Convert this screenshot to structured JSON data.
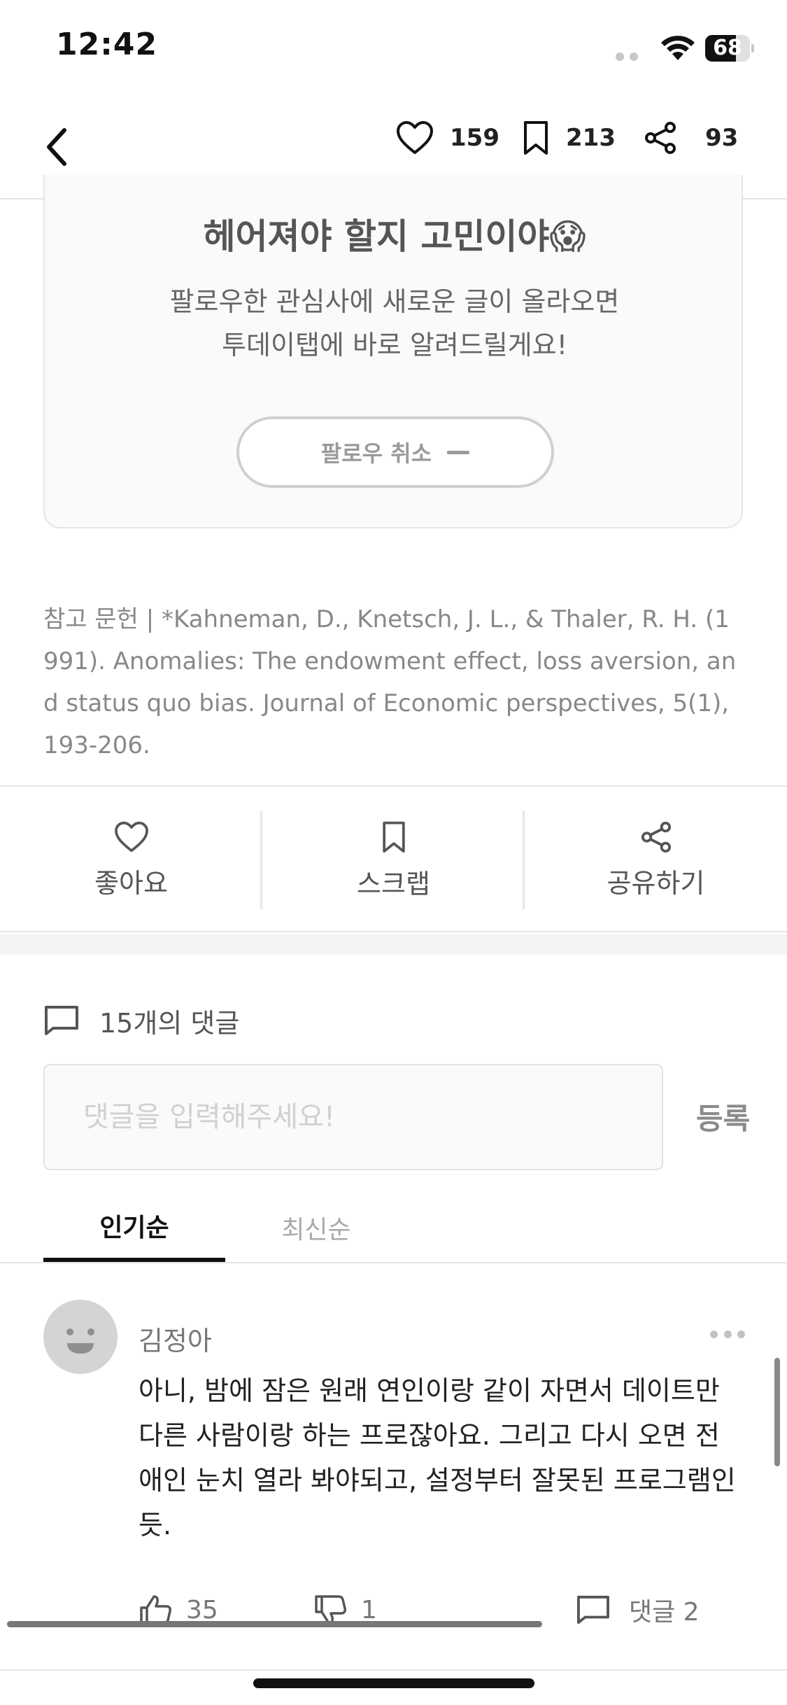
{
  "status_bar": {
    "time": "12:42",
    "battery": "68",
    "battery_level": 0.68
  },
  "nav": {
    "like_count": "159",
    "scrap_count": "213",
    "share_count": "93"
  },
  "follow_card": {
    "title": "헤어져야 할지 고민이야😱",
    "desc_line1": "팔로우한 관심사에 새로운 글이 올라오면",
    "desc_line2": "투데이탭에 바로 알려드릴게요!",
    "unfollow_label": "팔로우 취소"
  },
  "reference": {
    "text": "참고 문헌 | *Kahneman, D., Knetsch, J. L., & Thaler, R. H. (1991). Anomalies: The endowment effect, loss aversion, and status quo bias. Journal of Economic perspectives, 5(1), 193-206."
  },
  "actions": {
    "like_label": "좋아요",
    "scrap_label": "스크랩",
    "share_label": "공유하기"
  },
  "comments": {
    "count_label": "15개의 댓글",
    "input_placeholder": "댓글을 입력해주세요!",
    "submit_label": "등록",
    "tabs": [
      "인기순",
      "최신순"
    ],
    "items": [
      {
        "author": "김정아",
        "body": "아니, 밤에 잠은 원래 연인이랑 같이 자면서 데이트만 다른 사람이랑 하는 프로잖아요. 그리고 다시 오면 전 애인 눈치 열라 봐야되고, 설정부터 잘못된 프로그램인 듯.",
        "likes": "35",
        "dislikes": "1",
        "reply_label": "댓글 2"
      }
    ]
  }
}
